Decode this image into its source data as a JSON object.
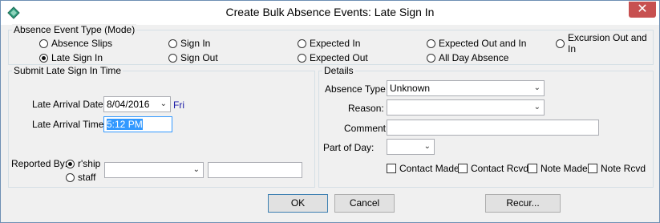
{
  "window": {
    "title": "Create Bulk Absence Events: Late Sign In",
    "close_label": "✕"
  },
  "mode_group": {
    "legend": "Absence Event Type (Mode)",
    "options": [
      {
        "label": "Absence Slips",
        "selected": false
      },
      {
        "label": "Sign In",
        "selected": false
      },
      {
        "label": "Expected In",
        "selected": false
      },
      {
        "label": "Expected Out and In",
        "selected": false
      },
      {
        "label": "Excursion Out and In",
        "selected": false
      },
      {
        "label": "Late Sign In",
        "selected": true
      },
      {
        "label": "Sign Out",
        "selected": false
      },
      {
        "label": "Expected Out",
        "selected": false
      },
      {
        "label": "All Day Absence",
        "selected": false
      }
    ]
  },
  "submit_group": {
    "legend": "Submit Late Sign In Time",
    "arrival_date_label": "Late Arrival Date:",
    "arrival_date_value": "8/04/2016",
    "arrival_day": "Fri",
    "arrival_time_label": "Late Arrival Time:",
    "arrival_time_value": "5:12 PM",
    "reported_by_label": "Reported By:",
    "reported_options": [
      {
        "label": "r'ship",
        "selected": true
      },
      {
        "label": "staff",
        "selected": false
      }
    ],
    "reporter_select_value": "",
    "reporter_text_value": ""
  },
  "details_group": {
    "legend": "Details",
    "absence_type_label": "Absence Type:",
    "absence_type_value": "Unknown",
    "reason_label": "Reason:",
    "reason_value": "",
    "comment_label": "Comment:",
    "comment_value": "",
    "part_of_day_label": "Part of Day:",
    "part_of_day_value": "",
    "checkboxes": [
      {
        "label": "Contact Made",
        "checked": false
      },
      {
        "label": "Contact Rcvd",
        "checked": false
      },
      {
        "label": "Note Made",
        "checked": false
      },
      {
        "label": "Note Rcvd",
        "checked": false
      }
    ]
  },
  "buttons": {
    "ok": "OK",
    "cancel": "Cancel",
    "recur": "Recur..."
  }
}
